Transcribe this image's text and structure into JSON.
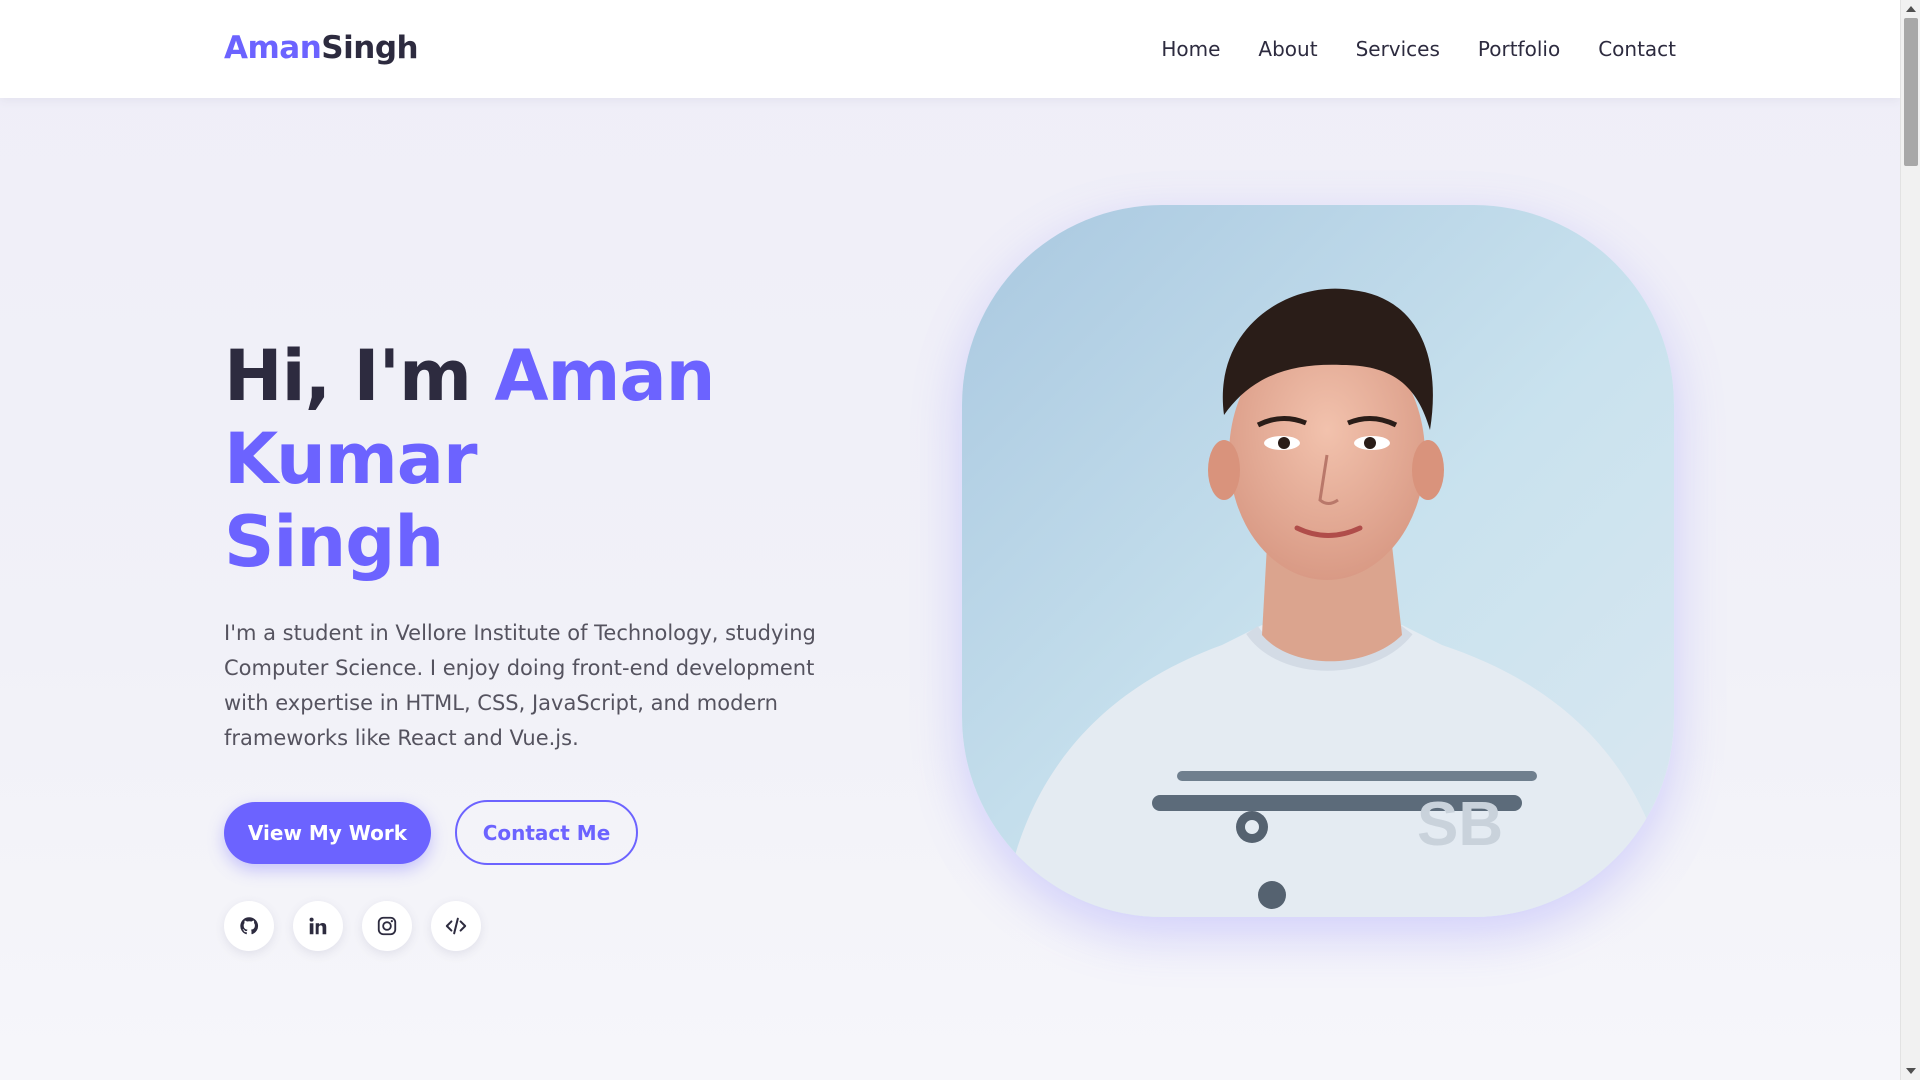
{
  "nav": {
    "logo_first": "Aman",
    "logo_second": "Singh",
    "links": [
      "Home",
      "About",
      "Services",
      "Portfolio",
      "Contact"
    ]
  },
  "hero": {
    "greeting": "Hi, I'm ",
    "name_line1": "Aman Kumar",
    "name_line2": "Singh",
    "description": "I'm a student in Vellore Institute of Technology, studying Computer Science. I enjoy doing front-end development with expertise in HTML, CSS, JavaScript, and modern frameworks like React and Vue.js.",
    "primary_button": "View My Work",
    "secondary_button": "Contact Me",
    "portrait_shirt_text": "SB"
  },
  "social_icons": [
    "github-icon",
    "linkedin-icon",
    "instagram-icon",
    "code-icon"
  ],
  "colors": {
    "accent": "#6c63ff",
    "text_dark": "#2d2b3f",
    "text_body": "#55535f",
    "background": "#f1f1f8"
  }
}
